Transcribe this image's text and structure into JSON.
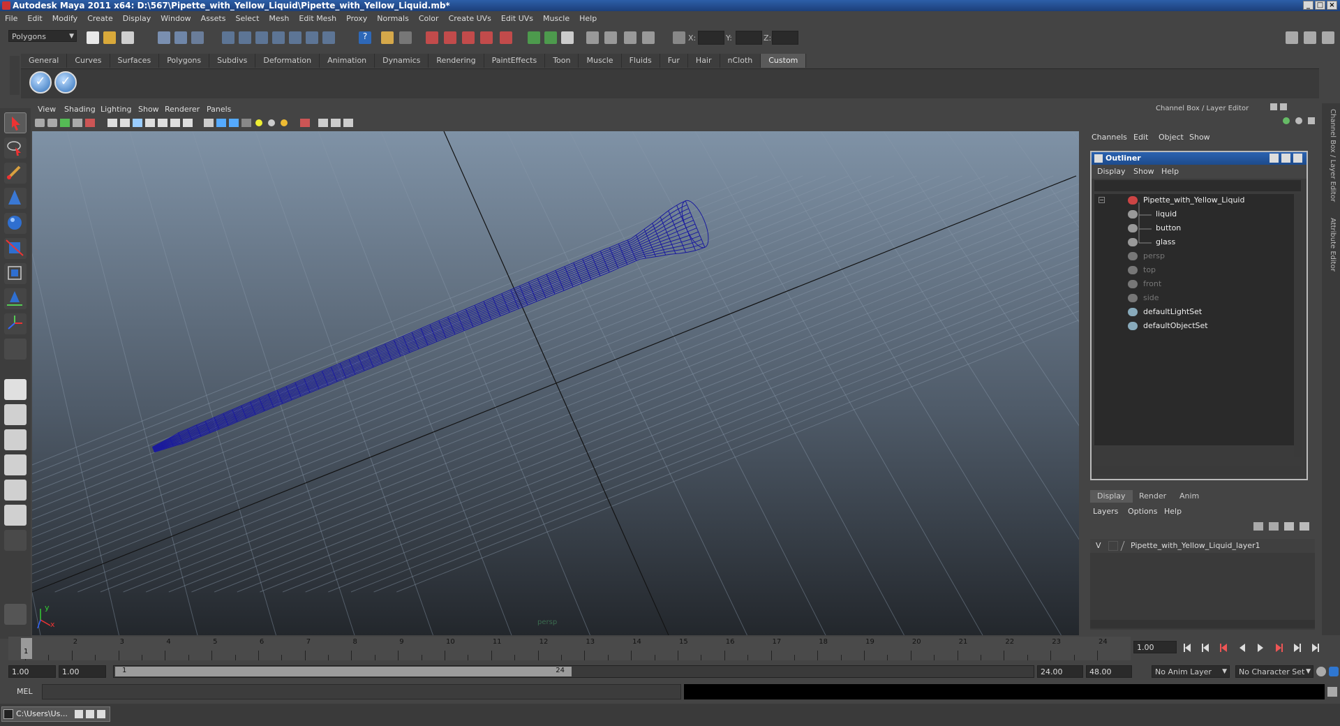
{
  "window": {
    "title": "Autodesk Maya 2011 x64: D:\\567\\Pipette_with_Yellow_Liquid\\Pipette_with_Yellow_Liquid.mb*",
    "minimize": "_",
    "maximize": "□",
    "close": "×"
  },
  "menubar": [
    "File",
    "Edit",
    "Modify",
    "Create",
    "Display",
    "Window",
    "Assets",
    "Select",
    "Mesh",
    "Edit Mesh",
    "Proxy",
    "Normals",
    "Color",
    "Create UVs",
    "Edit UVs",
    "Muscle",
    "Help"
  ],
  "statusline": {
    "mode": "Polygons",
    "x_label": "X:",
    "y_label": "Y:",
    "z_label": "Z:"
  },
  "shelf": {
    "tabs": [
      "General",
      "Curves",
      "Surfaces",
      "Polygons",
      "Subdivs",
      "Deformation",
      "Animation",
      "Dynamics",
      "Rendering",
      "PaintEffects",
      "Toon",
      "Muscle",
      "Fluids",
      "Fur",
      "Hair",
      "nCloth",
      "Custom"
    ],
    "active_tab": "Custom"
  },
  "viewport": {
    "menus": [
      "View",
      "Shading",
      "Lighting",
      "Show",
      "Renderer",
      "Panels"
    ],
    "camera_label": "persp",
    "axis_y": "y",
    "axis_x": "x"
  },
  "channel_box": {
    "title": "Channel Box / Layer Editor",
    "menus": [
      "Channels",
      "Edit",
      "Object",
      "Show"
    ]
  },
  "outliner": {
    "title": "Outliner",
    "menus": [
      "Display",
      "Show",
      "Help"
    ],
    "items": [
      {
        "label": "Pipette_with_Yellow_Liquid",
        "dim": false
      },
      {
        "label": "liquid",
        "dim": false
      },
      {
        "label": "button",
        "dim": false
      },
      {
        "label": "glass",
        "dim": false
      },
      {
        "label": "persp",
        "dim": true
      },
      {
        "label": "top",
        "dim": true
      },
      {
        "label": "front",
        "dim": true
      },
      {
        "label": "side",
        "dim": true
      },
      {
        "label": "defaultLightSet",
        "dim": false
      },
      {
        "label": "defaultObjectSet",
        "dim": false
      }
    ]
  },
  "layer_editor": {
    "tabs": [
      "Display",
      "Render",
      "Anim"
    ],
    "menus": [
      "Layers",
      "Options",
      "Help"
    ],
    "layer_visible": "V",
    "layer_name": "Pipette_with_Yellow_Liquid_layer1"
  },
  "side_tabs": [
    "Channel Box / Layer Editor",
    "Attribute Editor"
  ],
  "timeline": {
    "ticks": [
      "1",
      "2",
      "3",
      "4",
      "5",
      "6",
      "7",
      "8",
      "9",
      "10",
      "11",
      "12",
      "13",
      "14",
      "15",
      "16",
      "17",
      "18",
      "19",
      "20",
      "21",
      "22",
      "23",
      "24"
    ],
    "current_frame_marker": "1",
    "current_time": "1.00"
  },
  "range": {
    "start_time": "1.00",
    "playback_start": "1.00",
    "range_start": "1",
    "range_end": "24",
    "playback_end": "24.00",
    "end_time": "48.00",
    "anim_layer": "No Anim Layer",
    "character_set": "No Character Set"
  },
  "command_line": {
    "label": "MEL"
  },
  "taskbar": {
    "item": "C:\\Users\\Us..."
  }
}
